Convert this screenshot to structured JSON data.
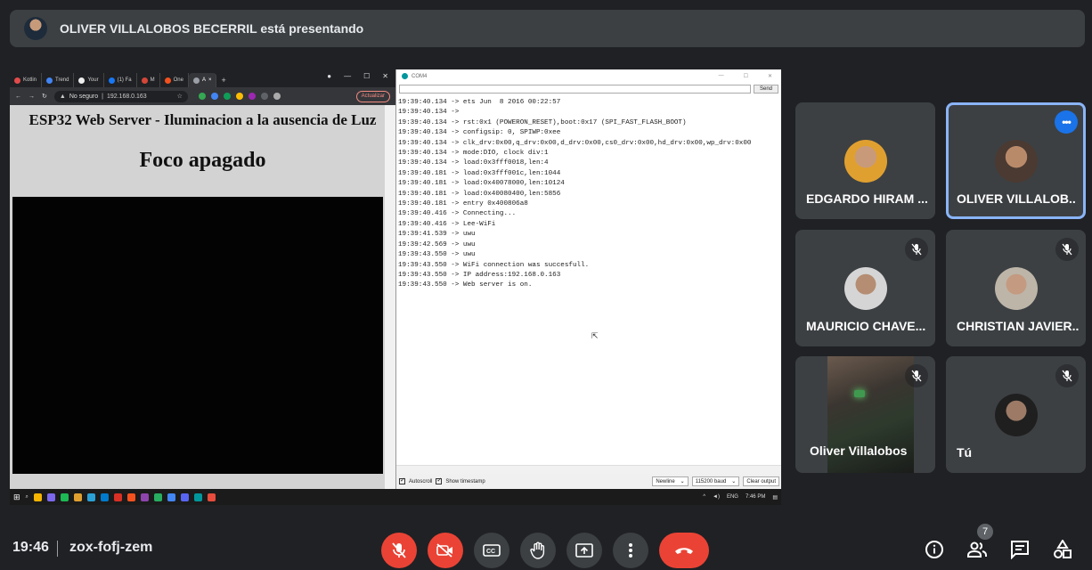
{
  "banner": {
    "presenter_text": "OLIVER VILLALOBOS BECERRIL está presentando"
  },
  "shared_screen": {
    "browser": {
      "tabs": [
        "Kotlin",
        "Trend",
        "Your",
        "(1) Fa",
        "M",
        "One",
        "A"
      ],
      "new_tab": "+",
      "url_security": "No seguro",
      "url": "192.168.0.163",
      "update_button": "Actualizar",
      "page_title": "ESP32 Web Server - Iluminacion a la ausencia de Luz",
      "status": "Foco apagado"
    },
    "serial_monitor": {
      "title": "COM4",
      "send_button": "Send",
      "lines": [
        "19:39:40.134 -> ets Jun  8 2016 00:22:57",
        "19:39:40.134 ->",
        "19:39:40.134 -> rst:0x1 (POWERON_RESET),boot:0x17 (SPI_FAST_FLASH_BOOT)",
        "19:39:40.134 -> configsip: 0, SPIWP:0xee",
        "19:39:40.134 -> clk_drv:0x00,q_drv:0x00,d_drv:0x00,cs0_drv:0x00,hd_drv:0x00,wp_drv:0x00",
        "19:39:40.134 -> mode:DIO, clock div:1",
        "19:39:40.134 -> load:0x3fff0018,len:4",
        "19:39:40.181 -> load:0x3fff001c,len:1044",
        "19:39:40.181 -> load:0x40078000,len:10124",
        "19:39:40.181 -> load:0x40080400,len:5856",
        "19:39:40.181 -> entry 0x400806a8",
        "19:39:40.416 -> Connecting...",
        "19:39:40.416 -> Lee-WiFi",
        "19:39:41.539 -> uwu",
        "19:39:42.569 -> uwu",
        "19:39:43.550 -> uwu",
        "19:39:43.550 -> WiFi connection was succesfull.",
        "19:39:43.550 -> IP address:192.168.0.163",
        "19:39:43.550 -> Web server is on."
      ],
      "autoscroll": "Autoscroll",
      "show_timestamp": "Show timestamp",
      "line_ending": "Newline",
      "baud": "115200 baud",
      "clear_button": "Clear output"
    },
    "taskbar": {
      "lang": "ENG",
      "time": "7:46 PM"
    }
  },
  "participants": [
    {
      "name": "EDGARDO HIRAM ...",
      "muted": false,
      "avatar_color": "#e0a030"
    },
    {
      "name": "OLIVER VILLALOB...",
      "muted": false,
      "avatar_color": "#6a4a3a",
      "selected": true
    },
    {
      "name": "MAURICIO CHAVE...",
      "muted": true,
      "avatar_color": "#c9c9c9"
    },
    {
      "name": "CHRISTIAN JAVIER...",
      "muted": true,
      "avatar_color": "#b0a89a"
    },
    {
      "name": "Oliver Villalobos",
      "muted": true,
      "video": true
    },
    {
      "name": "Tú",
      "muted": true,
      "avatar_color": "#2a2a2a"
    }
  ],
  "bottom_bar": {
    "time": "19:46",
    "meeting_code": "zox-fofj-zem",
    "people_count": "7"
  },
  "colors": {
    "background": "#202124",
    "tile": "#3c4043",
    "danger": "#ea4335",
    "accent": "#1a73e8",
    "highlight": "#8ab4f8"
  }
}
